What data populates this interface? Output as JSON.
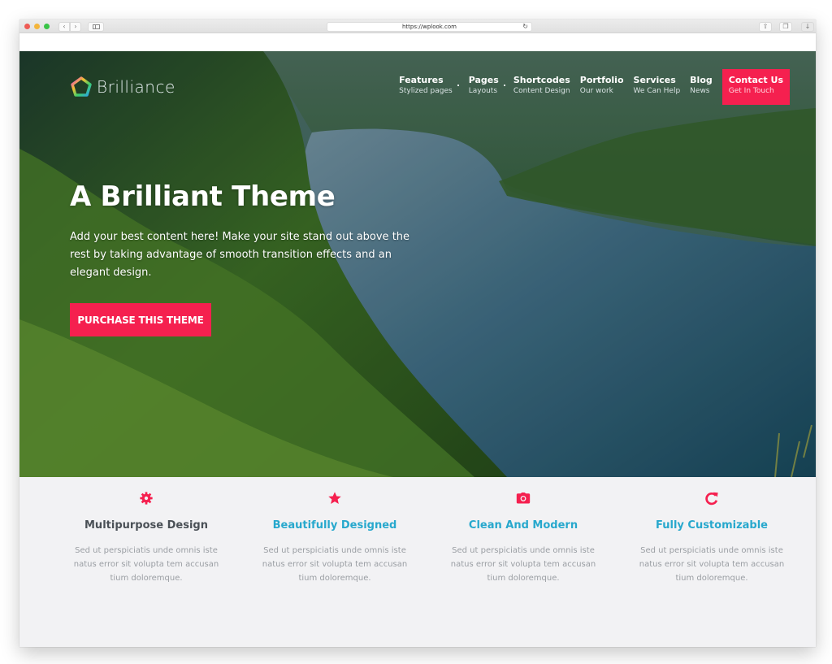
{
  "browser": {
    "url": "https://wplook.com",
    "back_icon": "‹",
    "forward_icon": "›",
    "reload_icon": "↻",
    "share_icon": "⇧",
    "tabs_icon": "❐",
    "download_icon": "↓"
  },
  "site": {
    "brand": "Brilliance",
    "accent_color": "#f5204f",
    "link_color": "#27a8cd",
    "nav": [
      {
        "label": "Features",
        "sub": "Stylized pages",
        "has_dropdown": true
      },
      {
        "label": "Pages",
        "sub": "Layouts",
        "has_dropdown": true
      },
      {
        "label": "Shortcodes",
        "sub": "Content Design",
        "has_dropdown": false
      },
      {
        "label": "Portfolio",
        "sub": "Our work",
        "has_dropdown": false
      },
      {
        "label": "Services",
        "sub": "We Can Help",
        "has_dropdown": false
      },
      {
        "label": "Blog",
        "sub": "News",
        "has_dropdown": false
      },
      {
        "label": "Contact Us",
        "sub": "Get In Touch",
        "highlighted": true
      }
    ]
  },
  "hero": {
    "title": "A Brilliant Theme",
    "description": "Add your best content here! Make your site stand out above the rest by taking advantage of smooth transition effects and an elegant design.",
    "cta_label": "PURCHASE THIS THEME"
  },
  "features": [
    {
      "icon": "gear-icon",
      "title": "Multipurpose Design",
      "text": "Sed ut perspiciatis unde omnis iste natus error sit volupta tem accusan tium doloremque."
    },
    {
      "icon": "star-icon",
      "title": "Beautifully Designed",
      "text": "Sed ut perspiciatis unde omnis iste natus error sit volupta tem accusan tium doloremque."
    },
    {
      "icon": "camera-icon",
      "title": "Clean And Modern",
      "text": "Sed ut perspiciatis unde omnis iste natus error sit volupta tem accusan tium doloremque."
    },
    {
      "icon": "refresh-icon",
      "title": "Fully Customizable",
      "text": "Sed ut perspiciatis unde omnis iste natus error sit volupta tem accusan tium doloremque."
    }
  ]
}
